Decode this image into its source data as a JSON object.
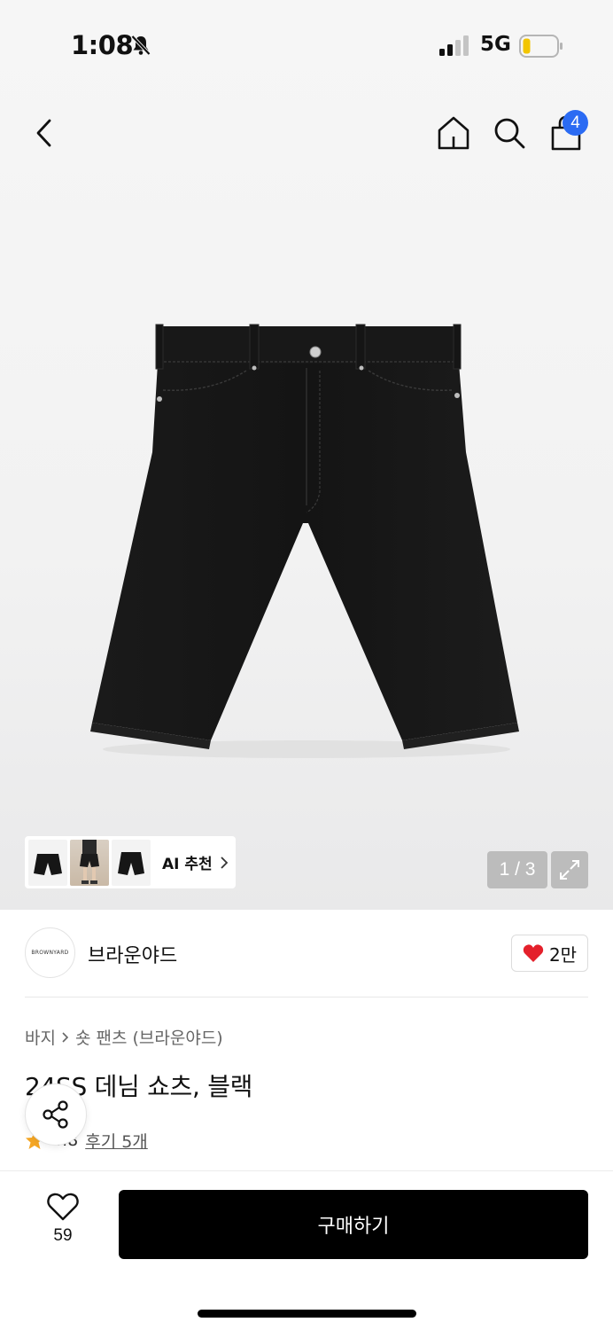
{
  "status_bar": {
    "time": "1:08",
    "network": "5G"
  },
  "nav": {
    "cart_count": "4"
  },
  "gallery": {
    "ai_label": "AI 추천",
    "page_indicator": "1 / 3"
  },
  "brand": {
    "logo_text": "BROWNYARD",
    "name": "브라운야드",
    "likes": "2만"
  },
  "breadcrumb": {
    "category": "바지",
    "subcategory": "숏 팬츠 (브라운야드)"
  },
  "product": {
    "title": "24SS 데님 쇼츠, 블랙",
    "rating": "4.8",
    "reviews": "후기 5개"
  },
  "bottom_bar": {
    "wish_count": "59",
    "buy_label": "구매하기"
  },
  "colors": {
    "accent_blue": "#2b6bf3",
    "heart_red": "#e4202b",
    "star": "#f5a623"
  }
}
